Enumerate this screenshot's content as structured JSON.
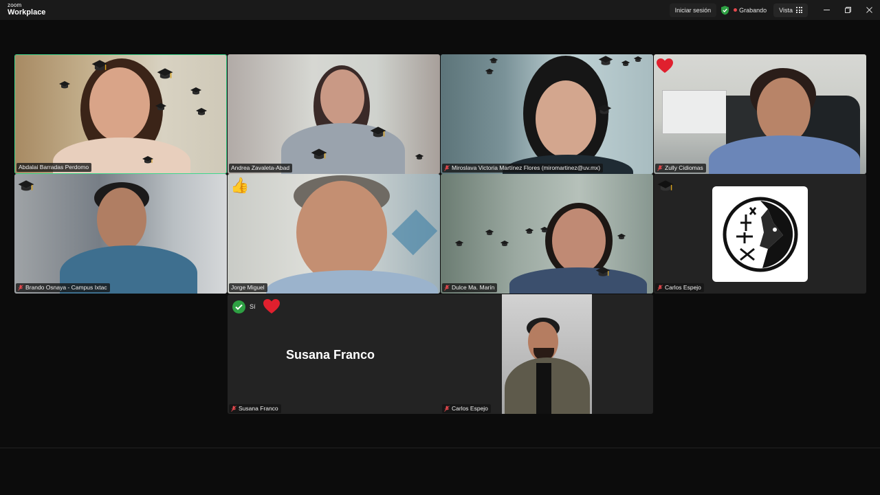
{
  "app": {
    "logo_top": "zoom",
    "logo_bottom": "Workplace",
    "signin_label": "Iniciar sesión",
    "recording_label": "Grabando",
    "view_label": "Vista"
  },
  "participants": [
    {
      "name": "Abdalai Barradas Perdomo",
      "muted": false,
      "active": true
    },
    {
      "name": "Andrea Zavaleta-Abad",
      "muted": false
    },
    {
      "name": "Miroslava Victoria Martínez Flores (miromartinez@uv.mx)",
      "muted": true
    },
    {
      "name": "Zully Cidiomas",
      "muted": true
    },
    {
      "name": "Brando Osnaya - Campus Ixtac",
      "muted": true
    },
    {
      "name": "Jorge Miguel",
      "muted": false
    },
    {
      "name": "Dulce Ma. Marín",
      "muted": true
    },
    {
      "name": "Carlos Espejo",
      "muted": true
    }
  ],
  "lower_row": {
    "display_name": "Susana Franco",
    "name_tag": "Susana Franco",
    "yes_label": "Sí",
    "share_name_tag": "Carlos Espejo"
  },
  "colors": {
    "active_border": "#3dd68c",
    "recording": "#e5484d",
    "shield": "#2ea043",
    "heart": "#e0202e"
  }
}
